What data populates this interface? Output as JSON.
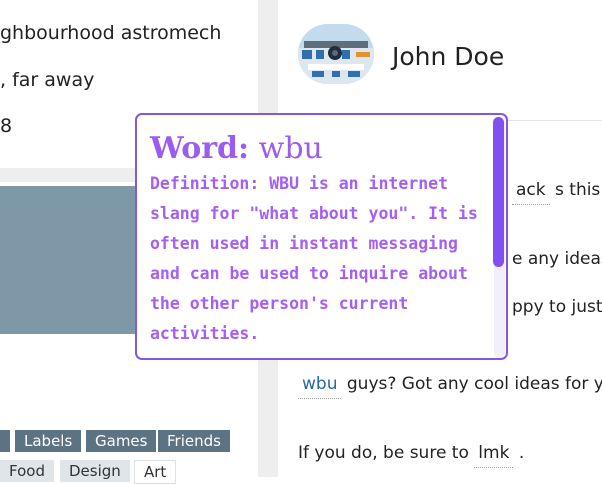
{
  "profile": {
    "lines": [
      "ghbourhood astromech",
      ", far away",
      "8"
    ],
    "tags_row1": [
      "",
      "Labels",
      "Games",
      "Friends"
    ],
    "tags_row2": [
      "Food",
      "Design",
      "Art"
    ]
  },
  "chat": {
    "user_name": "John Doe",
    "messages": [
      {
        "word": "ack",
        "rest": " s this y"
      },
      {
        "text": "e any ideas"
      },
      {
        "text": "ppy to just"
      },
      {
        "word": "wbu",
        "rest": " guys? Got any cool ideas for y"
      },
      {
        "prefix": "If you do, be sure to ",
        "word": "lmk",
        "rest": " ."
      }
    ]
  },
  "popup": {
    "title_label": "Word:",
    "title_word": "wbu",
    "definition": "Definition: WBU is an internet slang for \"what about you\". It is often used in instant messaging and can be used to inquire about the other person's current activities."
  },
  "colors": {
    "popup_accent": "#8257e6",
    "popup_text": "#a55ff2",
    "tag_dark": "#5c7383",
    "banner": "#7e98a7"
  },
  "icons": {
    "avatar": "r2d2-avatar-icon"
  }
}
